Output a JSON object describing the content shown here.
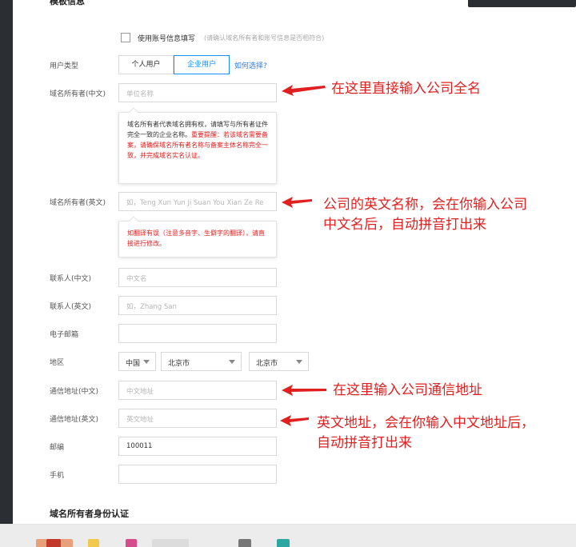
{
  "form": {
    "section_title": "模板信息",
    "use_account_info": {
      "label": "使用账号信息填写",
      "hint": "(请确认域名所有者和账号信息是否相符合)"
    },
    "user_type": {
      "label": "用户类型",
      "options": [
        "个人用户",
        "企业用户"
      ],
      "selected": "企业用户",
      "help_link": "如何选择?"
    },
    "owner_cn": {
      "label": "域名所有者(中文)",
      "placeholder": "单位名称",
      "tip_dark": "域名所有者代表域名拥有权，请填写与所有者证件完全一致的企业名称。",
      "tip_red": "重要提醒：若该域名需要备案，请确保域名所有者名称与备案主体名称完全一致，并完成域名实名认证。"
    },
    "owner_en": {
      "label": "域名所有者(英文)",
      "placeholder": "如，Teng Xun Yun Ji Suan You Xian  Ze Re",
      "tip_red": "如翻译有误（注意多音字、生僻字的翻译），请直接进行修改。"
    },
    "contact_cn": {
      "label": "联系人(中文)",
      "placeholder": "中文名"
    },
    "contact_en": {
      "label": "联系人(英文)",
      "placeholder": "如，Zhang San"
    },
    "email": {
      "label": "电子邮箱",
      "placeholder": ""
    },
    "region": {
      "label": "地区",
      "country": "中国",
      "province": "北京市",
      "city": "北京市"
    },
    "address_cn": {
      "label": "通信地址(中文)",
      "placeholder": "中文地址"
    },
    "address_en": {
      "label": "通信地址(英文)",
      "placeholder": "英文地址"
    },
    "zip": {
      "label": "邮编",
      "value": "100011"
    },
    "phone": {
      "label": "手机",
      "placeholder": ""
    },
    "section2_title": "域名所有者身份认证"
  },
  "annotations": {
    "a1": "在这里直接输入公司全名",
    "a2_line1": "公司的英文名称，会在你输入公司",
    "a2_line2": "中文名后，自动拼音打出来",
    "a3": "在这里输入公司通信地址",
    "a4_line1": "英文地址，会在你输入中文地址后，",
    "a4_line2": "自动拼音打出来"
  },
  "colors": {
    "accent": "#1890ff",
    "annotation_red": "#e02020",
    "link": "#2d7be5"
  }
}
